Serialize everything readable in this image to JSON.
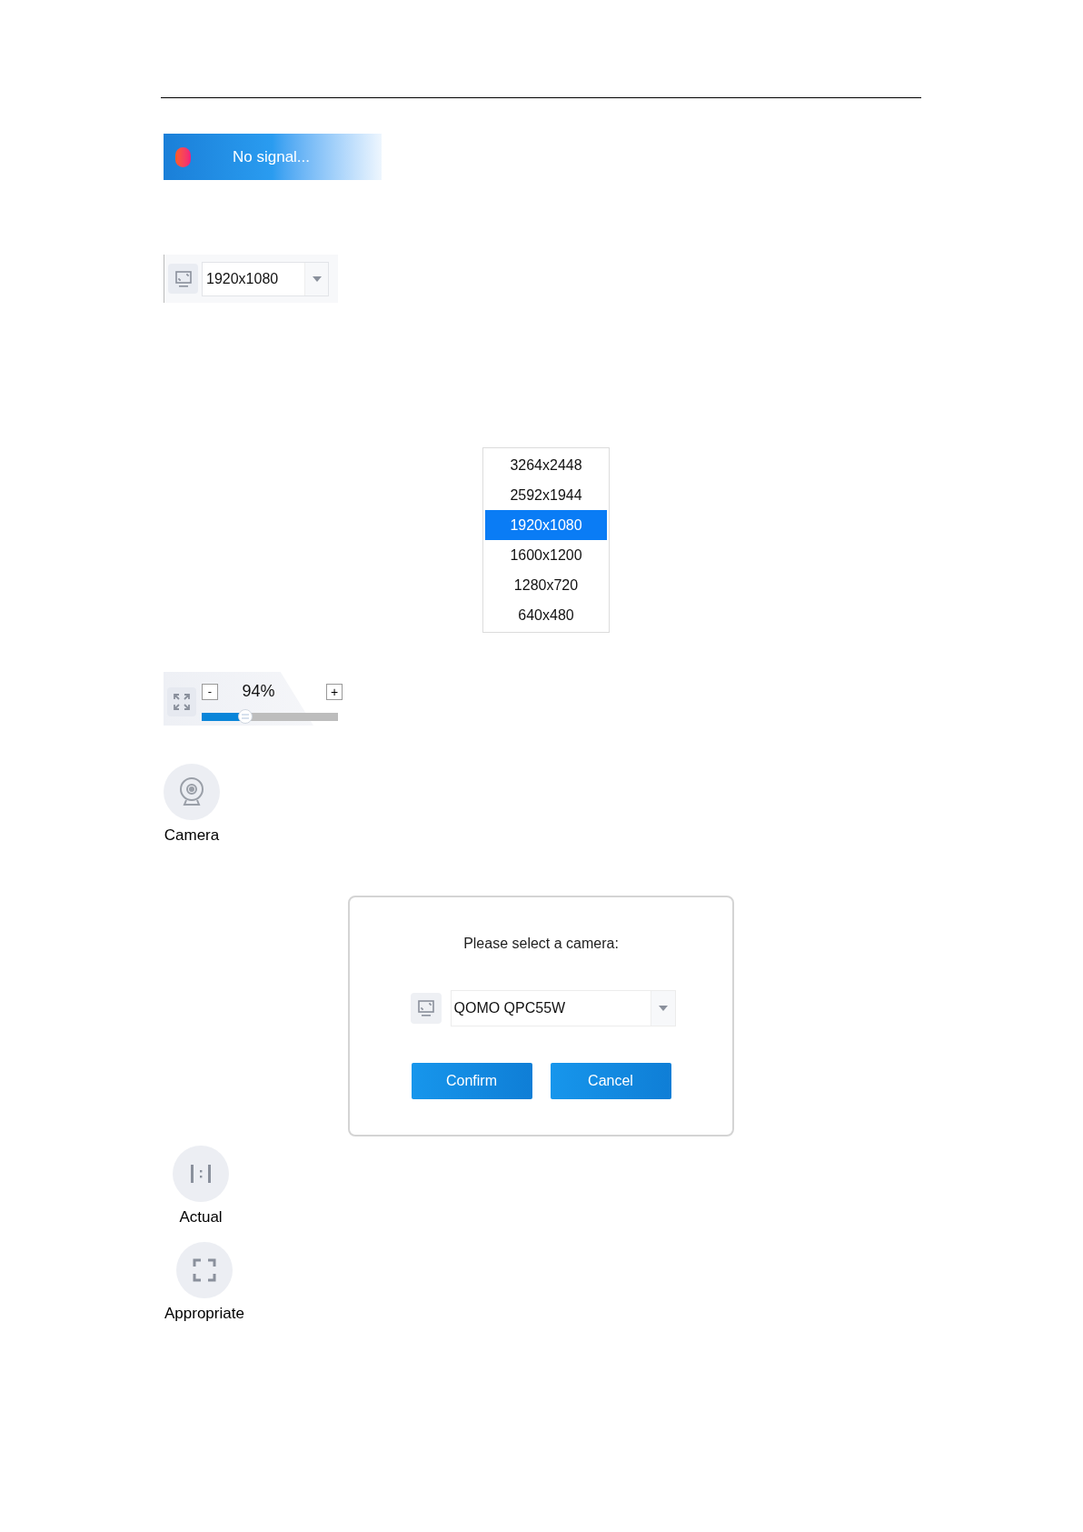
{
  "status_banner": {
    "text": "No signal..."
  },
  "resolution_selector": {
    "value": "1920x1080"
  },
  "resolution_list": [
    {
      "label": "3264x2448",
      "selected": false
    },
    {
      "label": "2592x1944",
      "selected": false
    },
    {
      "label": "1920x1080",
      "selected": true
    },
    {
      "label": "1600x1200",
      "selected": false
    },
    {
      "label": "1280x720",
      "selected": false
    },
    {
      "label": "640x480",
      "selected": false
    }
  ],
  "zoom_control": {
    "minus": "-",
    "reading": "94%",
    "plus": "+",
    "level": 0.32
  },
  "camera_button": {
    "label": "Camera"
  },
  "camera_dialog": {
    "prompt": "Please select a camera:",
    "camera": "QOMO QPC55W",
    "buttons": [
      "Confirm",
      "Cancel"
    ]
  },
  "actual_button": {
    "label": "Actual"
  },
  "appropriate_button": {
    "label": "Appropriate"
  }
}
